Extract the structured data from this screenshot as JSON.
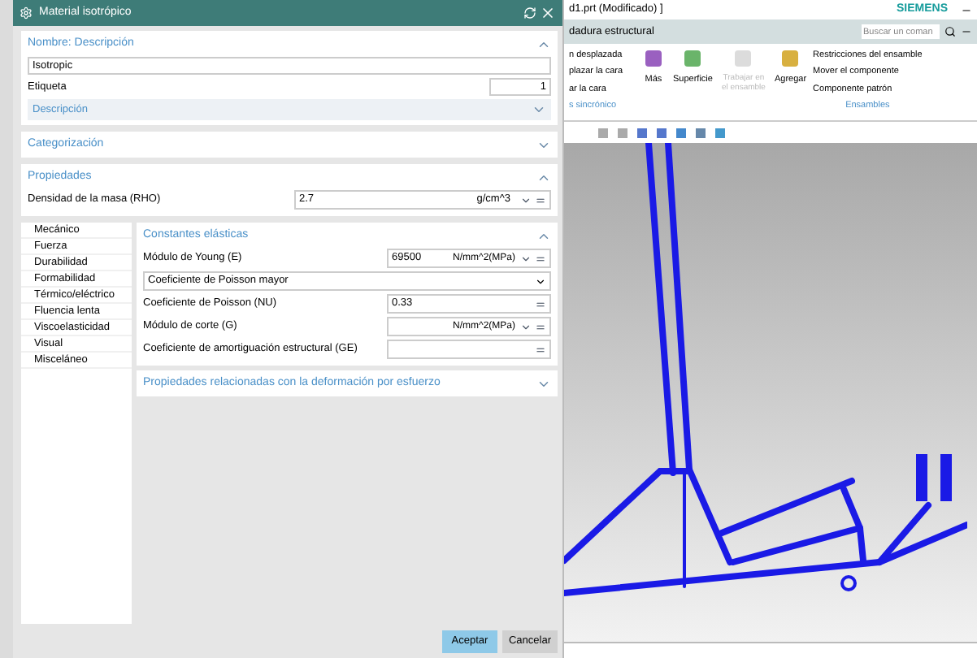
{
  "dialog": {
    "title": "Material isotrópico",
    "name_section": {
      "title": "Nombre: Descripción",
      "expanded": true,
      "name_value": "Isotropic",
      "label_caption": "Etiqueta",
      "label_value": "1",
      "description": {
        "title": "Descripción",
        "expanded": false
      }
    },
    "categorization": {
      "title": "Categorización",
      "expanded": false
    },
    "properties": {
      "title": "Propiedades",
      "expanded": true,
      "density": {
        "label": "Densidad de la masa (RHO)",
        "value": "2.7",
        "unit": "g/cm^3"
      }
    },
    "tree": [
      {
        "label": "Mecánico",
        "selected": false
      },
      {
        "label": "Fuerza",
        "selected": false
      },
      {
        "label": "Durabilidad",
        "selected": false
      },
      {
        "label": "Formabilidad",
        "selected": false
      },
      {
        "label": "Térmico/eléctrico",
        "selected": false
      },
      {
        "label": "Fluencia lenta",
        "selected": false
      },
      {
        "label": "Viscoelasticidad",
        "selected": false
      },
      {
        "label": "Visual",
        "selected": false
      },
      {
        "label": "Misceláneo",
        "selected": false
      }
    ],
    "elastic": {
      "title": "Constantes elásticas",
      "expanded": true,
      "rows": [
        {
          "kind": "field",
          "label": "Módulo de Young (E)",
          "value": "69500",
          "unit": "N/mm^2(MPa)"
        },
        {
          "kind": "dropdown",
          "label": "Coeficiente de Poisson mayor"
        },
        {
          "kind": "field",
          "label": "Coeficiente de Poisson (NU)",
          "value": "0.33"
        },
        {
          "kind": "field",
          "label": "Módulo de corte (G)",
          "unit": "N/mm^2(MPa)"
        },
        {
          "kind": "field",
          "label": "Coeficiente de amortiguación estructural (GE)"
        }
      ]
    },
    "stress": {
      "title": "Propiedades relacionadas con la deformación por esfuerzo",
      "expanded": false
    },
    "buttons": [
      {
        "label": "Aceptar",
        "kind": "primary"
      },
      {
        "label": "Cancelar",
        "kind": "secondary"
      }
    ]
  },
  "cad": {
    "title": "d1.prt (Modificado) ]",
    "brand": "SIEMENS",
    "tab": "dadura estructural",
    "search_placeholder": "Buscar un coman",
    "ribbon": {
      "sync_items": [
        "n desplazada",
        "plazar la cara",
        "ar la cara"
      ],
      "sync_group": "s sincrónico",
      "more": "Más",
      "surface": "Superficie",
      "work_in_assembly": {
        "label": "Trabajar en el ensamble",
        "disabled": true
      },
      "add": "Agregar",
      "assembly_items": [
        "Restricciones del ensamble",
        "Mover el componente",
        "Componente patrón"
      ],
      "assembly_group": "Ensambles"
    }
  }
}
